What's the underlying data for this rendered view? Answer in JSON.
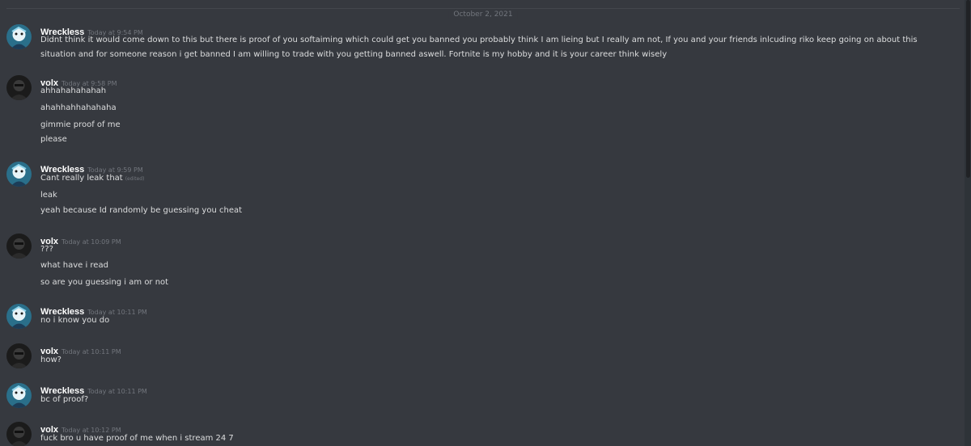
{
  "date_divider": "October 2, 2021",
  "colors": {
    "background": "#36393f",
    "text": "#dcddde",
    "muted": "#72767d",
    "username": "#ffffff"
  },
  "users": {
    "wreckless": {
      "name": "Wreckless",
      "avatar_icon": "wreckless-avatar-icon"
    },
    "volx": {
      "name": "volx",
      "avatar_icon": "volx-avatar-icon"
    }
  },
  "groups": [
    {
      "user": "Wreckless",
      "time": "Today at 9:54 PM",
      "lines": [
        "Didnt think it would come down to this but there is proof of you softaiming which could get you banned you probably think I am lieing but I really am not, If you and your friends inlcuding riko keep going on about this",
        "situation and for someone reason i get banned I am willing to trade with you getting banned aswell. Fortnite is my hobby and it is your career think wisely"
      ]
    },
    {
      "user": "volx",
      "time": "Today at 9:58 PM",
      "lines": [
        "ahhahahahahah",
        "ahahhahhahahaha",
        "gimmie proof of me",
        "please"
      ]
    },
    {
      "user": "Wreckless",
      "time": "Today at 9:59 PM",
      "lines": [
        "Cant really leak that",
        "leak",
        "yeah because Id randomly be guessing you cheat"
      ],
      "edited": "(edited)"
    },
    {
      "user": "volx",
      "time": "Today at 10:09 PM",
      "lines": [
        "???",
        "what have i read",
        "so are you guessing i am or not"
      ]
    },
    {
      "user": "Wreckless",
      "time": "Today at 10:11 PM",
      "lines": [
        "no i know you do"
      ]
    },
    {
      "user": "volx",
      "time": "Today at 10:11 PM",
      "lines": [
        "how?"
      ]
    },
    {
      "user": "Wreckless",
      "time": "Today at 10:11 PM",
      "lines": [
        "bc of proof?"
      ]
    },
    {
      "user": "volx",
      "time": "Today at 10:12 PM",
      "lines": [
        "fuck bro u have proof of me when i stream 24 7"
      ]
    }
  ]
}
